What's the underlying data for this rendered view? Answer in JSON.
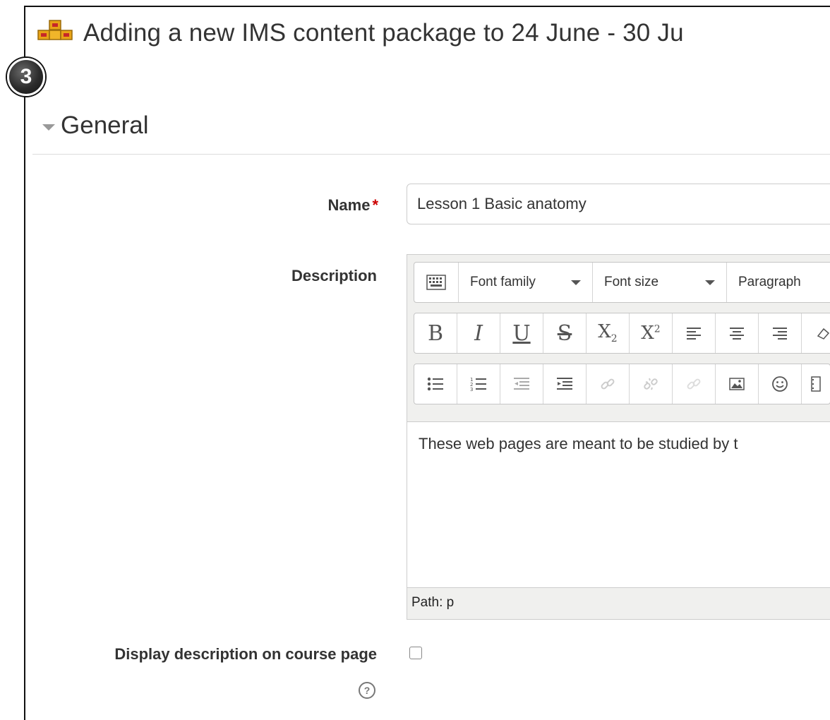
{
  "page": {
    "title": "Adding a new IMS content package to 24 June - 30 Ju",
    "step_number": "3"
  },
  "section": {
    "title": "General"
  },
  "form": {
    "name": {
      "label": "Name",
      "required_mark": "*",
      "value": "Lesson 1 Basic anatomy"
    },
    "description": {
      "label": "Description",
      "toolbar": {
        "font_family": "Font family",
        "font_size": "Font size",
        "paragraph": "Paragraph"
      },
      "content": "These web pages are meant to be studied by t",
      "path": "Path: p"
    },
    "display_description": {
      "label": "Display description on course page",
      "checked": false
    }
  },
  "icons": {
    "title": "ims-package-icon",
    "help": "help-icon"
  }
}
